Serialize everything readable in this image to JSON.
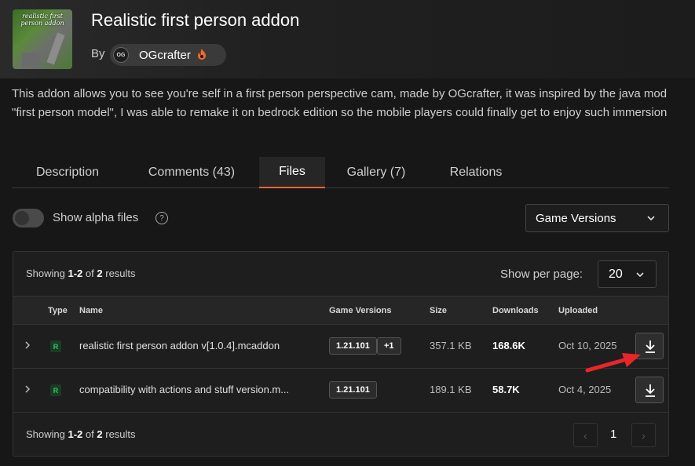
{
  "project": {
    "title": "Realistic first person addon",
    "thumbnail_text": "realistic first person addon",
    "by_label": "By",
    "author_initials": "OG",
    "author": "OGcrafter",
    "description": "This addon allows you to see you're self in a first person perspective cam, made by OGcrafter, it was inspired by the java mod \"first person model\", I was able to remake it on bedrock edition so the mobile players could finally get to enjoy such immersion"
  },
  "tabs": [
    {
      "label": "Description",
      "active": false
    },
    {
      "label": "Comments (43)",
      "active": false
    },
    {
      "label": "Files",
      "active": true
    },
    {
      "label": "Gallery (7)",
      "active": false
    },
    {
      "label": "Relations",
      "active": false
    }
  ],
  "filters": {
    "alpha_label": "Show alpha files",
    "alpha_enabled": false,
    "help_glyph": "?",
    "game_versions_label": "Game Versions"
  },
  "results": {
    "showing_prefix": "Showing",
    "range": "1-2",
    "of_word": "of",
    "total": "2",
    "results_word": "results",
    "per_page_label": "Show per page:",
    "per_page_value": "20"
  },
  "table": {
    "headers": {
      "type": "Type",
      "name": "Name",
      "versions": "Game Versions",
      "size": "Size",
      "downloads": "Downloads",
      "uploaded": "Uploaded"
    },
    "rows": [
      {
        "type": "R",
        "name": "realistic first person addon v[1.0.4].mcaddon",
        "version": "1.21.101",
        "extra_versions": "+1",
        "size": "357.1 KB",
        "downloads": "168.6K",
        "uploaded": "Oct 10, 2025"
      },
      {
        "type": "R",
        "name": "compatibility with actions and stuff version.m...",
        "version": "1.21.101",
        "extra_versions": "",
        "size": "189.1 KB",
        "downloads": "58.7K",
        "uploaded": "Oct 4, 2025"
      }
    ]
  },
  "pagination": {
    "current": "1",
    "prev_glyph": "‹",
    "next_glyph": "›"
  },
  "icons": {
    "expand": "chevron-right-icon",
    "download": "download-icon",
    "author_badge": "fire-icon",
    "dropdown": "chevron-down-icon",
    "annotation": "red-arrow"
  },
  "colors": {
    "accent": "#f16436",
    "release": "#37c26b",
    "annotation_arrow": "#e8262a"
  }
}
